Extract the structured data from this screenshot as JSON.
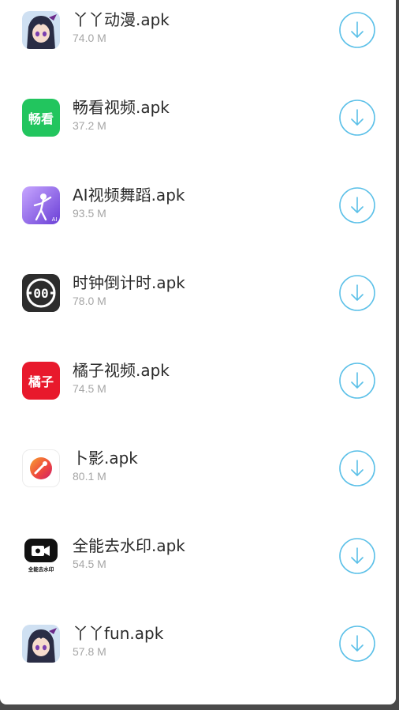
{
  "apps": [
    {
      "name": "丫丫动漫.apk",
      "size": "74.0 M",
      "icon": "anime-girl-icon"
    },
    {
      "name": "畅看视频.apk",
      "size": "37.2 M",
      "icon": "changkan-icon",
      "icon_text": "畅看",
      "icon_color": "#22c55e"
    },
    {
      "name": "AI视频舞蹈.apk",
      "size": "93.5 M",
      "icon": "ai-dance-icon",
      "icon_text": "AI",
      "icon_color": "#8b5cf6"
    },
    {
      "name": "时钟倒计时.apk",
      "size": "78.0 M",
      "icon": "countdown-clock-icon",
      "icon_text": "00",
      "icon_color": "#2d2d2d"
    },
    {
      "name": "橘子视频.apk",
      "size": "74.5 M",
      "icon": "juzi-icon",
      "icon_text": "橘子",
      "icon_color": "#e8192c"
    },
    {
      "name": "卜影.apk",
      "size": "80.1 M",
      "icon": "buying-icon",
      "icon_color": "#f05a3a"
    },
    {
      "name": "全能去水印.apk",
      "size": "54.5 M",
      "icon": "watermark-remover-icon",
      "icon_text": "全能去水印",
      "icon_color": "#111111"
    },
    {
      "name": "丫丫fun.apk",
      "size": "57.8 M",
      "icon": "anime-girl-icon"
    }
  ],
  "accent_color": "#5bc0e8"
}
